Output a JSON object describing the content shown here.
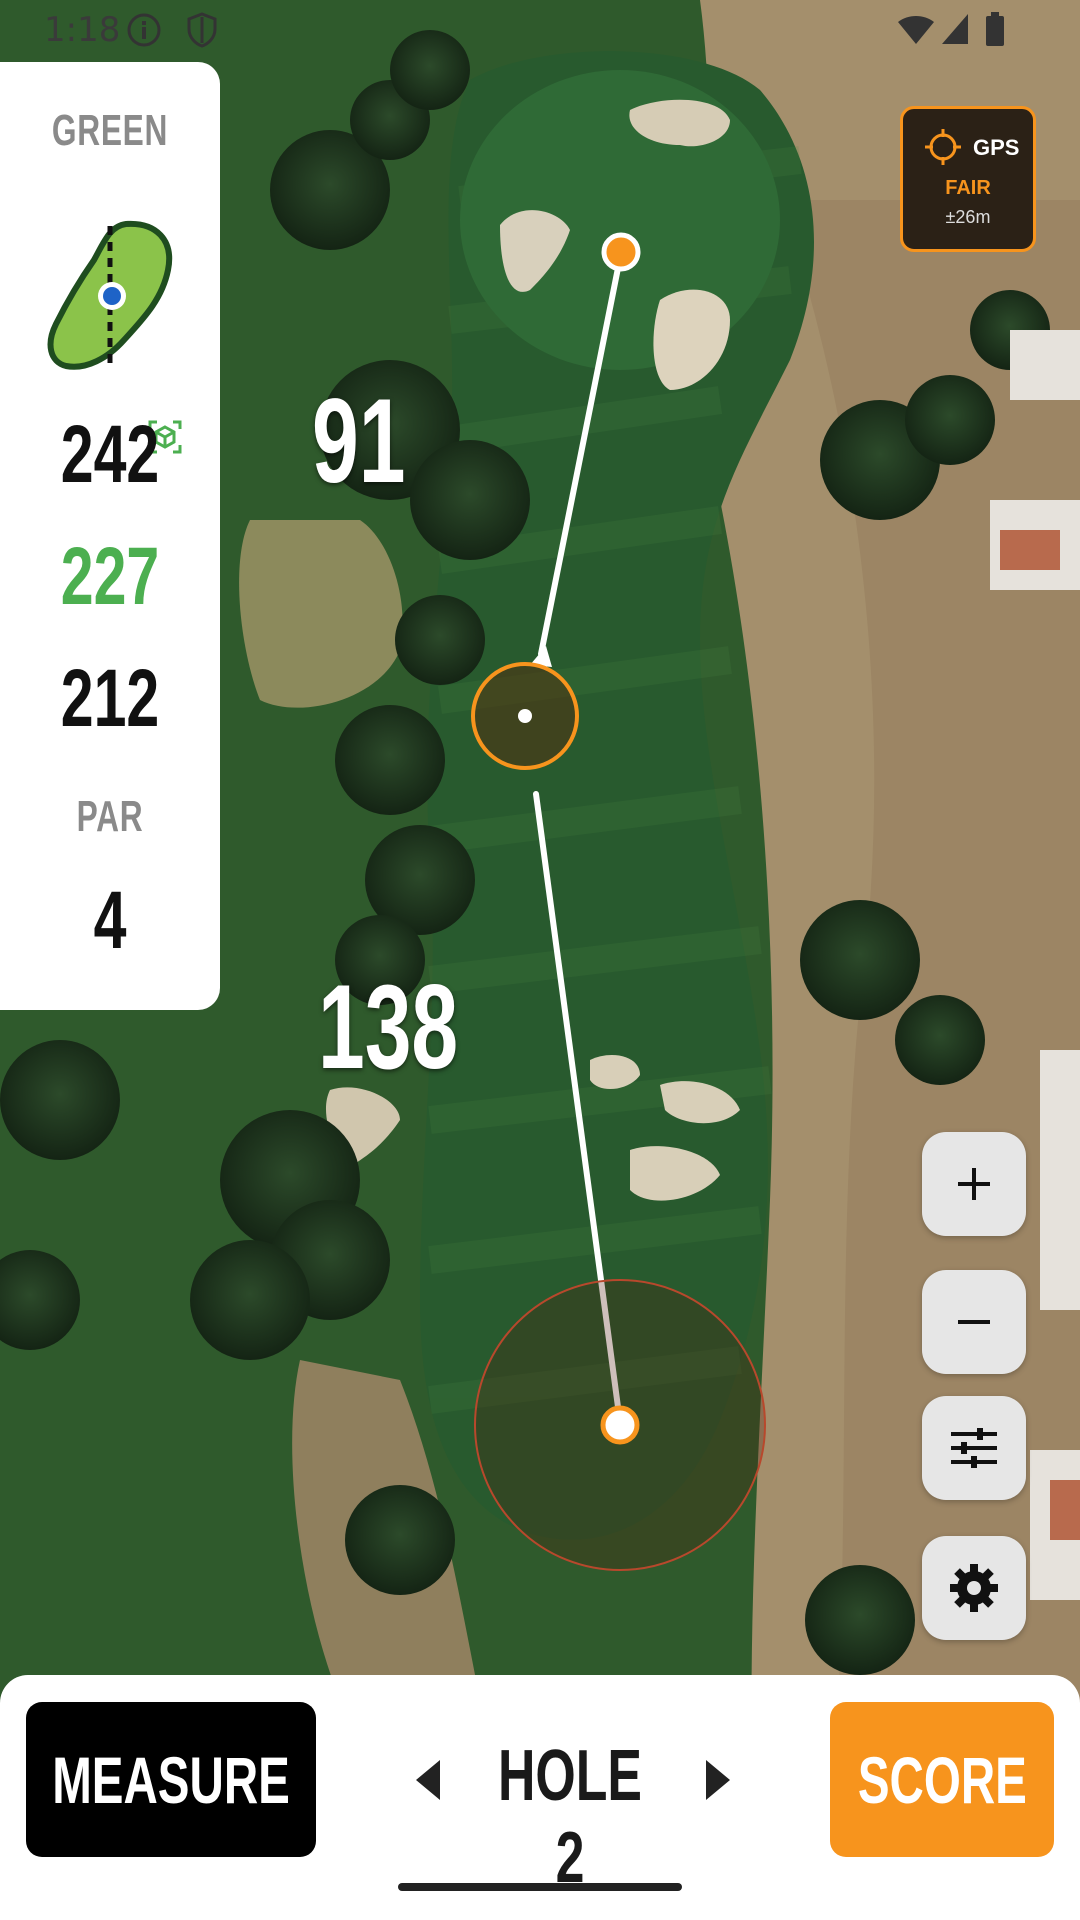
{
  "status_bar": {
    "time": "1:18",
    "icons": [
      "info-icon",
      "shield-icon",
      "wifi-icon",
      "signal-icon",
      "battery-icon"
    ]
  },
  "left_panel": {
    "green_label": "GREEN",
    "distances": {
      "back": "242",
      "middle": "227",
      "front": "212"
    },
    "par_label": "PAR",
    "par_value": "4"
  },
  "map": {
    "upper_distance": "91",
    "lower_distance": "138"
  },
  "gps": {
    "label": "GPS",
    "quality": "FAIR",
    "accuracy": "±26m"
  },
  "controls": {
    "zoom_in": "plus-icon",
    "zoom_out": "minus-icon",
    "filters": "sliders-icon",
    "settings": "gear-icon"
  },
  "bottom_bar": {
    "measure_label": "MEASURE",
    "hole_label": "HOLE 2",
    "score_label": "SCORE"
  },
  "colors": {
    "accent": "#f7941d",
    "green_value": "#4caf50"
  }
}
